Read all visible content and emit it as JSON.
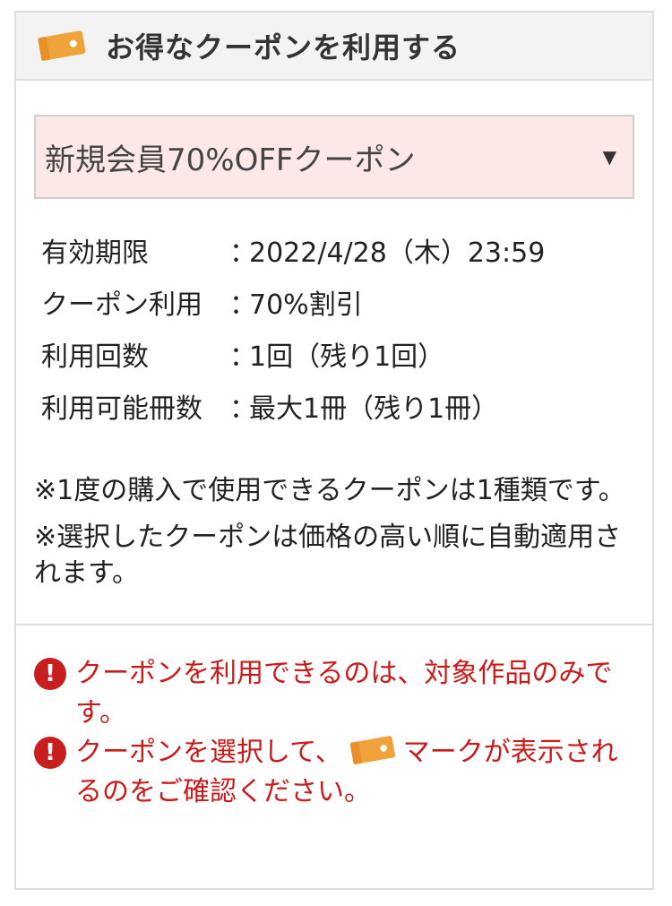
{
  "header": {
    "title": "お得なクーポンを利用する",
    "icon": "coupon-ticket-icon"
  },
  "coupon_select": {
    "selected_value": "新規会員70%OFFクーポン",
    "arrow": "▼"
  },
  "details": {
    "separator": "：",
    "rows": [
      {
        "label": "有効期限",
        "value": "2022/4/28（木）23:59"
      },
      {
        "label": "クーポン利用",
        "value": "70%割引"
      },
      {
        "label": "利用回数",
        "value": "1回（残り1回）"
      },
      {
        "label": "利用可能冊数",
        "value": "最大1冊（残り1冊）"
      }
    ]
  },
  "notes": [
    "※1度の購入で使用できるクーポンは1種類です。",
    "※選択したクーポンは価格の高い順に自動適用されます。"
  ],
  "warnings": {
    "icon_glyph": "!",
    "first": "クーポンを利用できるのは、対象作品のみです。",
    "second_before": "クーポンを選択して、",
    "second_after": "マークが表示されるのをご確認ください。"
  },
  "colors": {
    "accent_orange": "#f0a33a",
    "warning_red": "#cc1a1a",
    "select_background": "#fde8e8"
  }
}
